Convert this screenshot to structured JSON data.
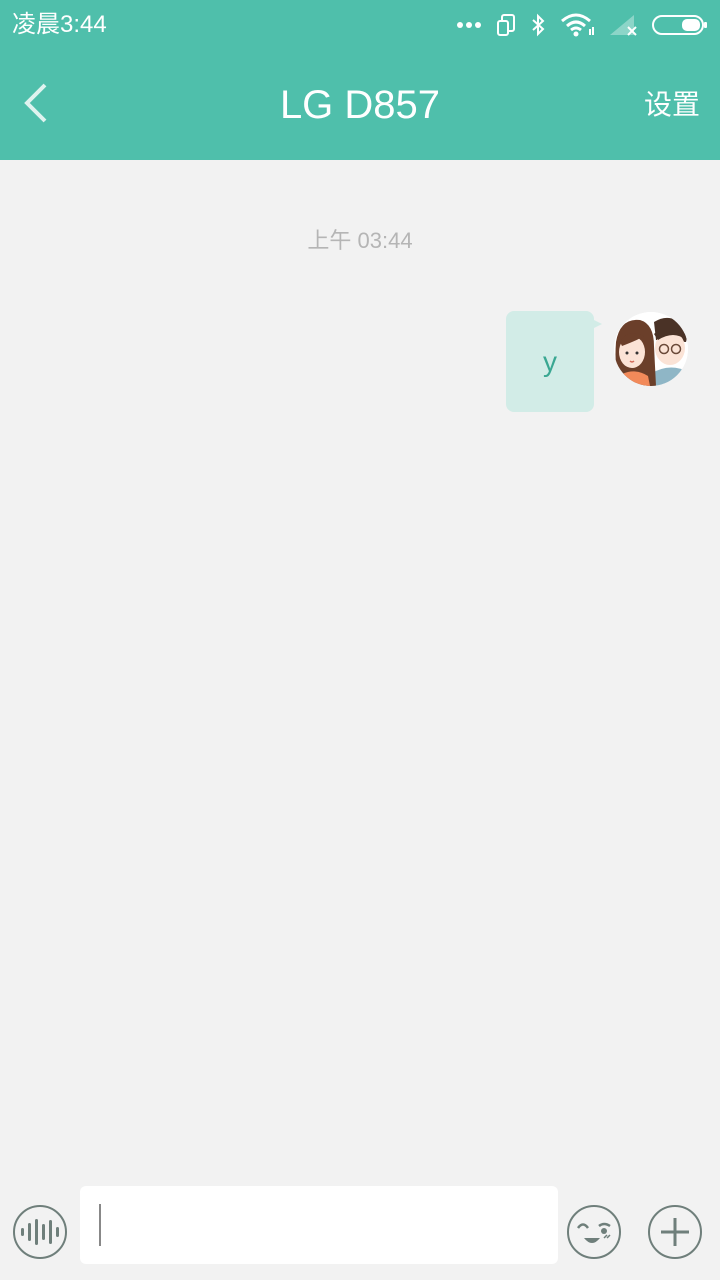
{
  "status_bar": {
    "time": "凌晨3:44",
    "icons": [
      "more-dots-icon",
      "screen-rotate-icon",
      "bluetooth-icon",
      "wifi-icon",
      "signal-no-service-icon",
      "battery-icon"
    ]
  },
  "header": {
    "title": "LG D857",
    "back_icon": "chevron-left-icon",
    "settings_label": "设置"
  },
  "conversation": {
    "timestamp": "上午 03:44",
    "messages": [
      {
        "direction": "outgoing",
        "text": "y",
        "avatar": "couple-avatar"
      }
    ]
  },
  "input_bar": {
    "voice_icon": "voice-wave-icon",
    "input_value": "",
    "emoji_icon": "emoji-face-icon",
    "plus_icon": "plus-icon"
  },
  "colors": {
    "accent": "#4fbfab",
    "bubble": "#d2ece7",
    "bubble_text": "#3aa792",
    "background": "#f2f2f2",
    "timestamp": "#b5b5b5",
    "icon_gray": "#6f7f7b"
  }
}
